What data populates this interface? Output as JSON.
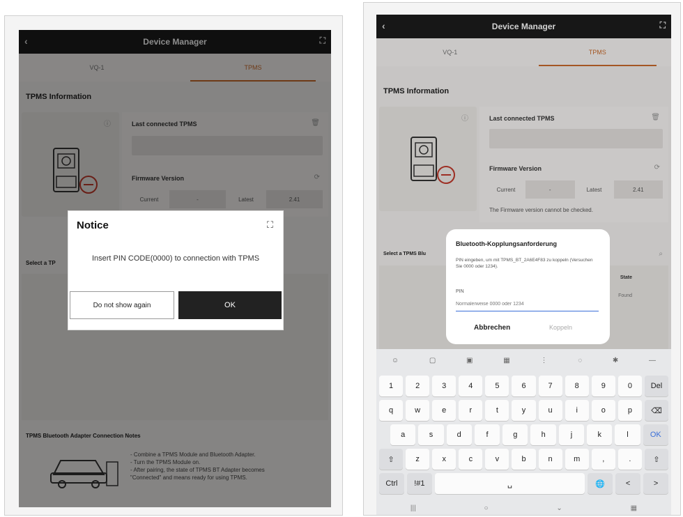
{
  "left": {
    "title": "Device Manager",
    "tabs": [
      "VQ-1",
      "TPMS"
    ],
    "section_title": "TPMS Information",
    "last_connected_label": "Last connected TPMS",
    "firmware_label": "Firmware Version",
    "fw_current": "Current",
    "fw_current_value": "-",
    "fw_latest": "Latest",
    "fw_latest_value": "2.41",
    "select_label": "Select a TP",
    "notes_title": "TPMS Bluetooth Adapter Connection Notes",
    "notes": [
      "- Combine a TPMS Module and Bluetooth Adapter.",
      "- Turn the TPMS Module on.",
      "- After pairing, the state of TPMS BT Adapter becomes",
      "\"Connected\" and means ready for using TPMS."
    ],
    "notice": {
      "title": "Notice",
      "message": "Insert PIN CODE(0000) to connection with TPMS",
      "btn_no_show": "Do not show again",
      "btn_ok": "OK"
    }
  },
  "right": {
    "title": "Device Manager",
    "tabs": [
      "VQ-1",
      "TPMS"
    ],
    "section_title": "TPMS Information",
    "last_connected_label": "Last connected TPMS",
    "firmware_label": "Firmware Version",
    "fw_current": "Current",
    "fw_current_value": "-",
    "fw_latest": "Latest",
    "fw_latest_value": "2.41",
    "fw_note": "The Firmware version cannot be checked.",
    "select_label": "Select a TPMS Blu",
    "state_label": "State",
    "state_value": "Found",
    "bt_dialog": {
      "title": "Bluetooth-Kopplungsanforderung",
      "text": "PIN eingeben, um mit TPMS_BT_2A6E4F83 zu koppeln (Versuchen Sie 0000 oder 1234).",
      "pin_label": "PIN",
      "pin_placeholder": "Normalerweise 0000 oder 1234",
      "cancel": "Abbrechen",
      "pair": "Koppeln"
    },
    "keyboard": {
      "row1": [
        "1",
        "2",
        "3",
        "4",
        "5",
        "6",
        "7",
        "8",
        "9",
        "0",
        "Del"
      ],
      "row2": [
        "q",
        "w",
        "e",
        "r",
        "t",
        "y",
        "u",
        "i",
        "o",
        "p"
      ],
      "row3": [
        "a",
        "s",
        "d",
        "f",
        "g",
        "h",
        "j",
        "k",
        "l",
        "OK"
      ],
      "row4": [
        "z",
        "x",
        "c",
        "v",
        "b",
        "n",
        "m",
        ",",
        "."
      ],
      "row5_left": [
        "Ctrl",
        "!#1"
      ],
      "row5_right": [
        "<",
        ">"
      ]
    }
  }
}
